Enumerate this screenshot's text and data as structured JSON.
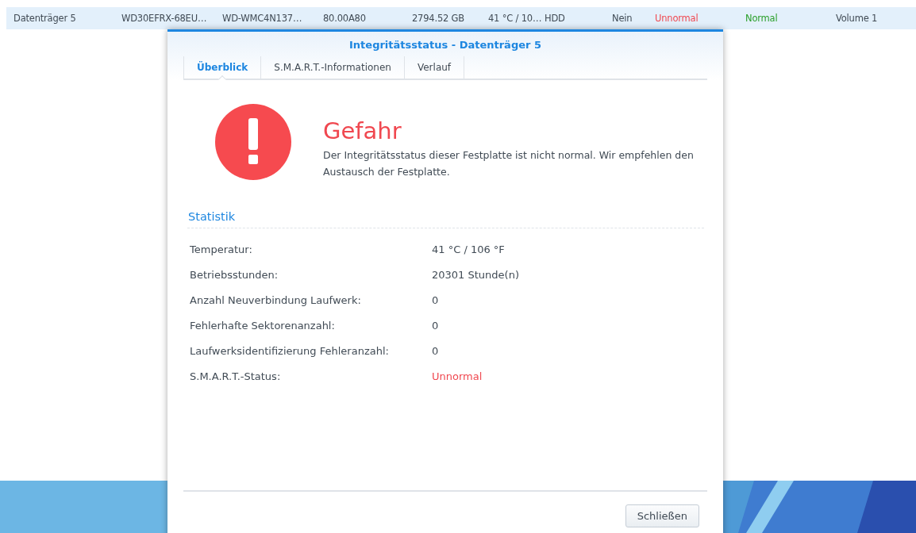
{
  "disk_row": {
    "selected": true,
    "cells": [
      {
        "text": "Datenträger 5",
        "kind": "plain"
      },
      {
        "text": "WD30EFRX-68EU…",
        "kind": "plain"
      },
      {
        "text": "WD-WMC4N137…",
        "kind": "plain"
      },
      {
        "text": "80.00A80",
        "kind": "plain"
      },
      {
        "text": "2794.52 GB",
        "kind": "plain"
      },
      {
        "text": "41 °C / 10…",
        "kind": "plain"
      },
      {
        "text": "HDD",
        "kind": "plain"
      },
      {
        "text": "Nein",
        "kind": "plain"
      },
      {
        "text": "Unnormal",
        "kind": "bad"
      },
      {
        "text": "Normal",
        "kind": "good"
      },
      {
        "text": "Volume 1",
        "kind": "plain"
      }
    ]
  },
  "dialog": {
    "title": "Integritätsstatus - Datenträger 5",
    "tabs": [
      {
        "label": "Überblick",
        "selected": true
      },
      {
        "label": "S.M.A.R.T.-Informationen",
        "selected": false
      },
      {
        "label": "Verlauf",
        "selected": false
      }
    ],
    "status": {
      "kind": "danger",
      "heading": "Gefahr",
      "message": "Der Integritätsstatus dieser Festplatte ist nicht normal. Wir empfehlen den Austausch der Festplatte."
    },
    "section_title": "Statistik",
    "stats": [
      {
        "label": "Temperatur:",
        "value": "41 °C / 106 °F",
        "kind": "plain"
      },
      {
        "label": "Betriebsstunden:",
        "value": "20301 Stunde(n)",
        "kind": "plain"
      },
      {
        "label": "Anzahl Neuverbindung Laufwerk:",
        "value": "0",
        "kind": "plain"
      },
      {
        "label": "Fehlerhafte Sektorenanzahl:",
        "value": "0",
        "kind": "plain"
      },
      {
        "label": "Laufwerksidentifizierung Fehleranzahl:",
        "value": "0",
        "kind": "plain"
      },
      {
        "label": "S.M.A.R.T.-Status:",
        "value": "Unnormal",
        "kind": "bad"
      }
    ],
    "buttons": [
      "Schließen"
    ]
  }
}
